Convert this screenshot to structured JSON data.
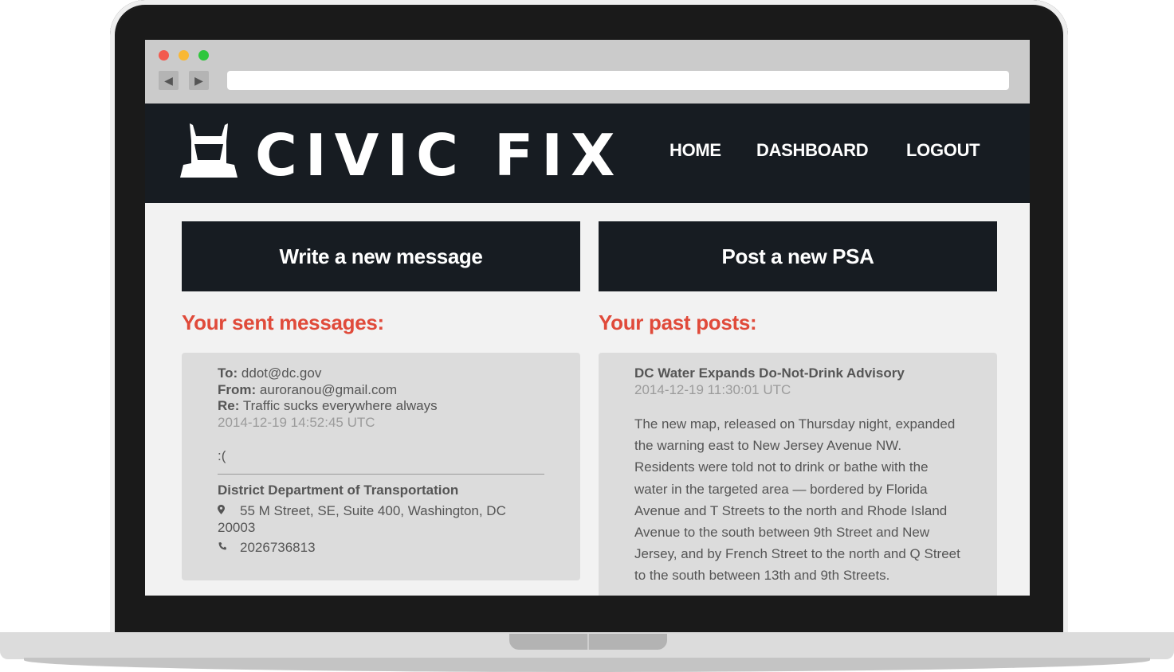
{
  "browser": {
    "url": ""
  },
  "site": {
    "logo_text": "CIVIC FIX",
    "nav": [
      "HOME",
      "DASHBOARD",
      "LOGOUT"
    ]
  },
  "actions": {
    "write_message": "Write a new message",
    "post_psa": "Post a new PSA"
  },
  "sent_messages": {
    "title": "Your sent messages:",
    "items": [
      {
        "to_label": "To:",
        "to": "ddot@dc.gov",
        "from_label": "From:",
        "from": "auroranou@gmail.com",
        "re_label": "Re:",
        "re": "Traffic sucks everywhere always",
        "timestamp": "2014-12-19 14:52:45 UTC",
        "body": ":(",
        "department": "District Department of Transportation",
        "address_line1": "55 M Street, SE, Suite 400, Washington, DC",
        "address_line2": "20003",
        "phone": "2026736813"
      }
    ]
  },
  "past_posts": {
    "title": "Your past posts:",
    "items": [
      {
        "title": "DC Water Expands Do-Not-Drink Advisory",
        "timestamp": "2014-12-19 11:30:01 UTC",
        "body": "The new map, released on Thursday night, expanded the warning east to New Jersey Avenue NW. Residents were told not to drink or bathe with the water in the targeted area — bordered by Florida Avenue and T Streets to the north and Rhode Island Avenue to the south between 9th Street and New Jersey, and by French Street to the north and Q Street to the south between 13th and 9th Streets."
      }
    ]
  },
  "colors": {
    "header_bg": "#171c22",
    "accent_red": "#e04a3a",
    "card_bg": "#dcdcdc",
    "page_bg": "#f2f2f2"
  },
  "icons": {
    "logo": "hooded-figure-icon",
    "address": "map-pin-icon",
    "phone": "phone-icon",
    "back": "back-arrow-icon",
    "forward": "forward-arrow-icon"
  }
}
